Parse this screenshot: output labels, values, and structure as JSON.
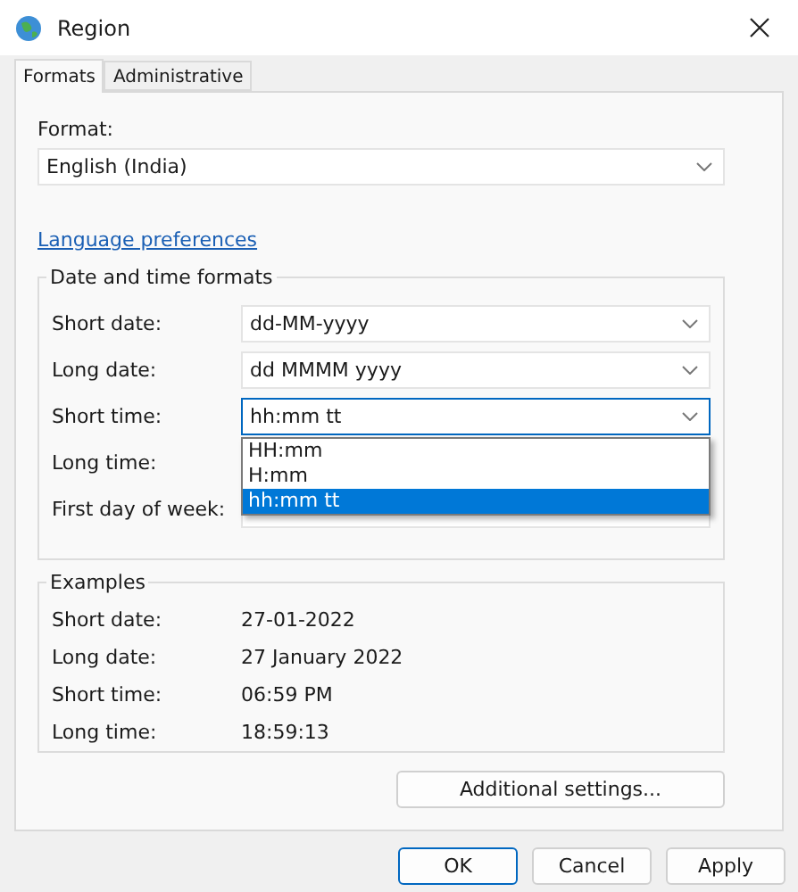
{
  "window": {
    "title": "Region"
  },
  "tabs": [
    {
      "label": "Formats",
      "selected": true
    },
    {
      "label": "Administrative",
      "selected": false
    }
  ],
  "format": {
    "label": "Format:",
    "value": "English (India)"
  },
  "language_link": "Language preferences",
  "date_time_formats": {
    "title": "Date and time formats",
    "rows": [
      {
        "label": "Short date:",
        "value": "dd-MM-yyyy"
      },
      {
        "label": "Long date:",
        "value": "dd MMMM yyyy"
      },
      {
        "label": "Short time:",
        "value": "hh:mm tt",
        "focused": true,
        "options": [
          {
            "label": "HH:mm",
            "selected": false
          },
          {
            "label": "H:mm",
            "selected": false
          },
          {
            "label": "hh:mm tt",
            "selected": true
          }
        ]
      },
      {
        "label": "Long time:"
      },
      {
        "label": "First day of week:"
      }
    ]
  },
  "examples": {
    "title": "Examples",
    "rows": [
      {
        "label": "Short date:",
        "value": "27-01-2022"
      },
      {
        "label": "Long date:",
        "value": "27 January 2022"
      },
      {
        "label": "Short time:",
        "value": "06:59 PM"
      },
      {
        "label": "Long time:",
        "value": "18:59:13"
      }
    ]
  },
  "additional_button": "Additional settings...",
  "buttons": [
    {
      "label": "OK",
      "default": true
    },
    {
      "label": "Cancel",
      "default": false
    },
    {
      "label": "Apply",
      "default": false
    }
  ]
}
